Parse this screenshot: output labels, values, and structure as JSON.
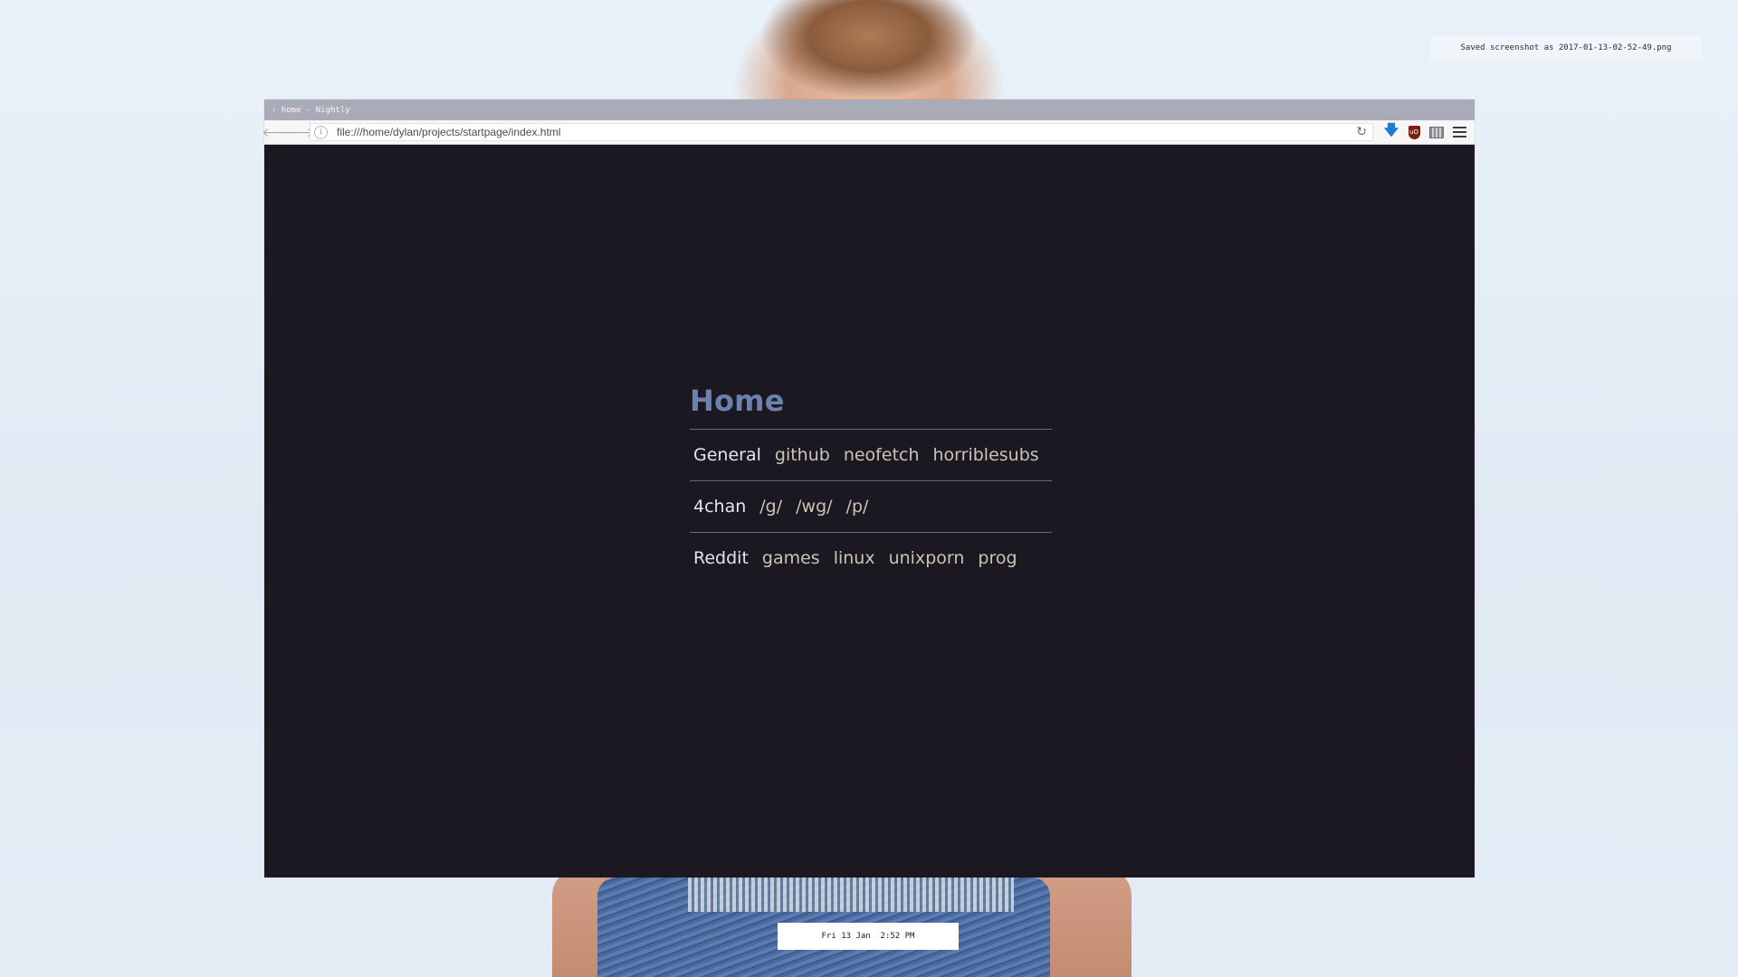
{
  "notification": {
    "text": "Saved screenshot as 2017-01-13-02-52-49.png"
  },
  "window": {
    "title": "home - Nightly"
  },
  "navbar": {
    "url": "file:///home/dylan/projects/startpage/index.html",
    "back_icon": "arrow-left",
    "forward_icon": "arrow-right",
    "info_icon": "info",
    "reload_icon": "reload",
    "toolbar_icons": [
      "download-arrow",
      "ublock-origin",
      "screenshot",
      "hamburger-menu"
    ]
  },
  "startpage": {
    "title": "Home",
    "sections": [
      {
        "category": "General",
        "links": [
          "github",
          "neofetch",
          "horriblesubs"
        ]
      },
      {
        "category": "4chan",
        "links": [
          "/g/",
          "/wg/",
          "/p/"
        ]
      },
      {
        "category": "Reddit",
        "links": [
          "games",
          "linux",
          "unixporn",
          "prog"
        ]
      }
    ]
  },
  "clock": {
    "text": "Fri 13 Jan  2:52 PM"
  },
  "colors": {
    "page_background": "#1b1822",
    "title": "#6b82ad",
    "category": "#e6e4ea",
    "link": "#c9c4b4",
    "divider": "#6a6872",
    "titlebar": "#a9acb8"
  }
}
